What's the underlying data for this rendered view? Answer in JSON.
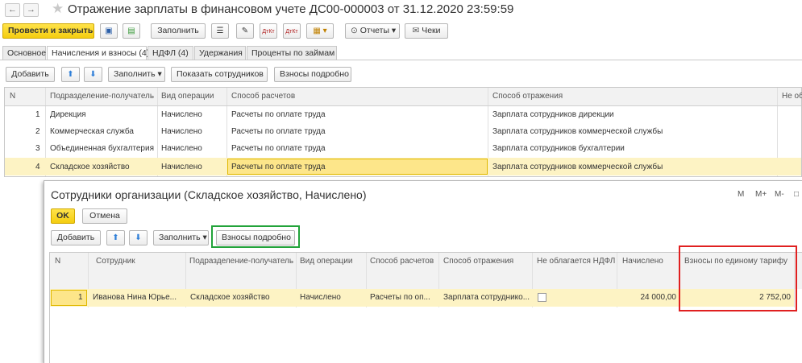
{
  "window": {
    "title": "Отражение зарплаты в финансовом учете ДС00-000003 от 31.12.2020 23:59:59"
  },
  "toolbar": {
    "post_close": "Провести и закрыть",
    "fill": "Заполнить",
    "reports": "Отчеты",
    "checks": "Чеки"
  },
  "tabs": [
    "Основное",
    "Начисления и взносы (4)",
    "НДФЛ (4)",
    "Удержания",
    "Проценты по займам"
  ],
  "main_toolbar": {
    "add": "Добавить",
    "fill": "Заполнить",
    "show_employees": "Показать сотрудников",
    "contrib_detail": "Взносы подробно"
  },
  "main_table": {
    "headers": [
      "N",
      "Подразделение-получатель",
      "Вид операции",
      "Способ расчетов",
      "Способ отражения",
      "Не об"
    ],
    "rows": [
      {
        "n": "1",
        "dept": "Дирекция",
        "op": "Начислено",
        "calc": "Расчеты по оплате труда",
        "refl": "Зарплата сотрудников дирекции"
      },
      {
        "n": "2",
        "dept": "Коммерческая служба",
        "op": "Начислено",
        "calc": "Расчеты по оплате труда",
        "refl": "Зарплата сотрудников коммерческой службы"
      },
      {
        "n": "3",
        "dept": "Объединенная бухгалтерия",
        "op": "Начислено",
        "calc": "Расчеты по оплате труда",
        "refl": "Зарплата сотрудников бухгалтерии"
      },
      {
        "n": "4",
        "dept": "Складское хозяйство",
        "op": "Начислено",
        "calc": "Расчеты по оплате труда",
        "refl": "Зарплата сотрудников коммерческой службы"
      }
    ]
  },
  "subform": {
    "title": "Сотрудники организации (Складское хозяйство, Начислено)",
    "window_controls": [
      "M",
      "M+",
      "M-",
      "□"
    ],
    "ok": "OK",
    "cancel": "Отмена",
    "add": "Добавить",
    "fill": "Заполнить",
    "contrib_detail": "Взносы подробно",
    "table": {
      "headers": [
        "N",
        "Сотрудник",
        "Подразделение-получатель",
        "Вид операции",
        "Способ расчетов",
        "Способ отражения",
        "Не облагается НДФЛ",
        "Начислено",
        "Взносы по единому тарифу"
      ],
      "row": {
        "n": "1",
        "employee": "Иванова Нина Юрье...",
        "dept": "Складское хозяйство",
        "op": "Начислено",
        "calc": "Расчеты по оп...",
        "refl": "Зарплата сотруднико...",
        "accrued": "24 000,00",
        "contrib": "2 752,00"
      }
    }
  },
  "colors": {
    "highlight_row": "#fdf3c4",
    "selected_cell": "#fde68a",
    "green_frame": "#22a33a",
    "red_frame": "#e02020",
    "yellow_button": "#f4cd10"
  }
}
